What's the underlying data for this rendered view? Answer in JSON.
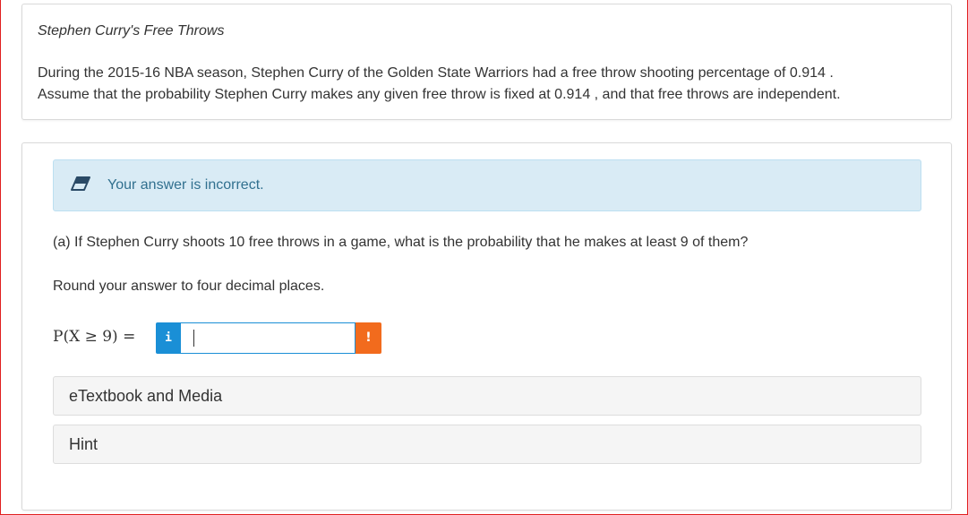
{
  "intro": {
    "title": "Stephen Curry's Free Throws",
    "line1": "During the 2015-16 NBA season, Stephen Curry of the Golden State Warriors had a free throw shooting percentage of 0.914 .",
    "line2": "Assume that the probability Stephen Curry makes any given free throw is fixed at 0.914 , and that free throws are independent."
  },
  "feedback": {
    "icon": "eraser-icon",
    "message": "Your answer is incorrect.",
    "color": "#31708f",
    "background": "#d9ebf5"
  },
  "question": {
    "part_a": "(a) If Stephen Curry shoots 10 free throws in a game, what is the probability that he makes at least 9 of them?",
    "instruction": "Round your answer to four decimal places.",
    "math_label": "P(X ≥ 9) =",
    "answer_value": "",
    "info_label": "i",
    "warning_label": "!"
  },
  "colors": {
    "info": "#1a8fd6",
    "warning": "#f26b1d"
  },
  "accordions": [
    {
      "label": "eTextbook and Media"
    },
    {
      "label": "Hint"
    }
  ]
}
